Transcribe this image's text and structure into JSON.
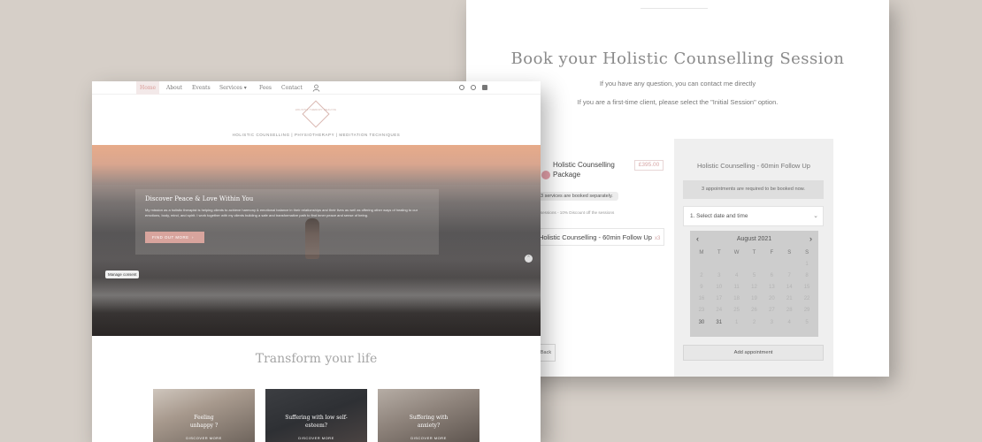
{
  "booking": {
    "title": "Book your Holistic Counselling Session",
    "subtitle": "If you have any question, you can contact me directly",
    "hint": "If you are a first-time client, please select the \"Initial Session\" option.",
    "package": {
      "title": "Holistic Counselling Package",
      "price": "£395.00",
      "pill": "3 services are booked separately.",
      "discount": "3 sessions - 10% Discount off the sessions",
      "session": "Holistic Counselling - 60min Follow Up",
      "session_badge": "x3",
      "back_label": "Back"
    },
    "service": {
      "title": "Holistic Counselling - 60min Follow Up",
      "note": "3 appointments are required to be booked now.",
      "select_label": "1. Select date and time",
      "month": "August 2021",
      "weekdays": [
        "M",
        "T",
        "W",
        "T",
        "F",
        "S",
        "S"
      ],
      "days": [
        "",
        "",
        "",
        "",
        "",
        "",
        "1",
        "2",
        "3",
        "4",
        "5",
        "6",
        "7",
        "8",
        "9",
        "10",
        "11",
        "12",
        "13",
        "14",
        "15",
        "16",
        "17",
        "18",
        "19",
        "20",
        "21",
        "22",
        "23",
        "24",
        "25",
        "26",
        "27",
        "28",
        "29",
        "30",
        "31",
        "1",
        "2",
        "3",
        "4",
        "5"
      ],
      "add_label": "Add appointment"
    }
  },
  "home": {
    "nav": {
      "home": "Home",
      "about": "About",
      "events": "Events",
      "services": "Services ▾",
      "fees": "Fees",
      "contact": "Contact"
    },
    "logo_text": "HOLISTIC THERAPY HEALING",
    "tagline": "HOLISTIC COUNSELLING | PHYSIOTHERAPY | MEDITATION TECHNIQUES",
    "hero": {
      "heading": "Discover Peace & Love Within You",
      "body": "My mission as a holistic therapist is helping clients to achieve harmony & emotional balance in their relationships and their lives as well as offering other ways of healing to our emotions, body, mind, and spirit. I work together with my clients building a safe and transformative path to find inner peace and sense of being.",
      "button": "FIND OUT MORE",
      "manage": "Manage consent"
    },
    "transform_title": "Transform your life",
    "cards": [
      {
        "title": "Feeling unhappy ?",
        "link": "DISCOVER MORE"
      },
      {
        "title": "Suffering with low self-esteem?",
        "link": "DISCOVER MORE"
      },
      {
        "title": "Suffering with anxiety?",
        "link": "DISCOVER MORE"
      }
    ]
  },
  "colors": {
    "background": "#d6cfc8",
    "accent": "#d8a49d",
    "title_grey": "#8a8a8a"
  }
}
